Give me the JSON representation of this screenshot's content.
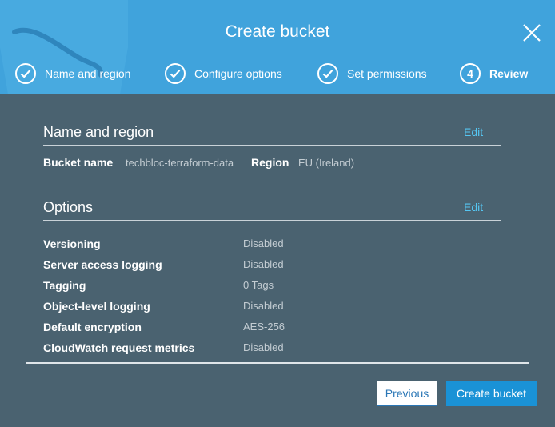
{
  "dialog": {
    "title": "Create bucket",
    "close_icon": "close-icon"
  },
  "steps": [
    {
      "label": "Name and region",
      "state": "done",
      "icon": "check-circle-icon"
    },
    {
      "label": "Configure options",
      "state": "done",
      "icon": "check-circle-icon"
    },
    {
      "label": "Set permissions",
      "state": "done",
      "icon": "check-circle-icon"
    },
    {
      "label": "Review",
      "state": "active",
      "number": "4"
    }
  ],
  "name_region": {
    "title": "Name and region",
    "edit_label": "Edit",
    "bucket_name_label": "Bucket name",
    "bucket_name_value": "techbloc-terraform-data",
    "region_label": "Region",
    "region_value": "EU (Ireland)"
  },
  "options": {
    "title": "Options",
    "edit_label": "Edit",
    "rows": [
      {
        "label": "Versioning",
        "value": "Disabled"
      },
      {
        "label": "Server access logging",
        "value": "Disabled"
      },
      {
        "label": "Tagging",
        "value": "0 Tags"
      },
      {
        "label": "Object-level logging",
        "value": "Disabled"
      },
      {
        "label": "Default encryption",
        "value": "AES-256"
      },
      {
        "label": "CloudWatch request metrics",
        "value": "Disabled"
      }
    ]
  },
  "footer": {
    "previous_label": "Previous",
    "create_label": "Create bucket"
  },
  "colors": {
    "header": "#40a3dc",
    "body": "#4a6270",
    "link": "#55c6f2",
    "primary_button": "#1a92d6"
  }
}
